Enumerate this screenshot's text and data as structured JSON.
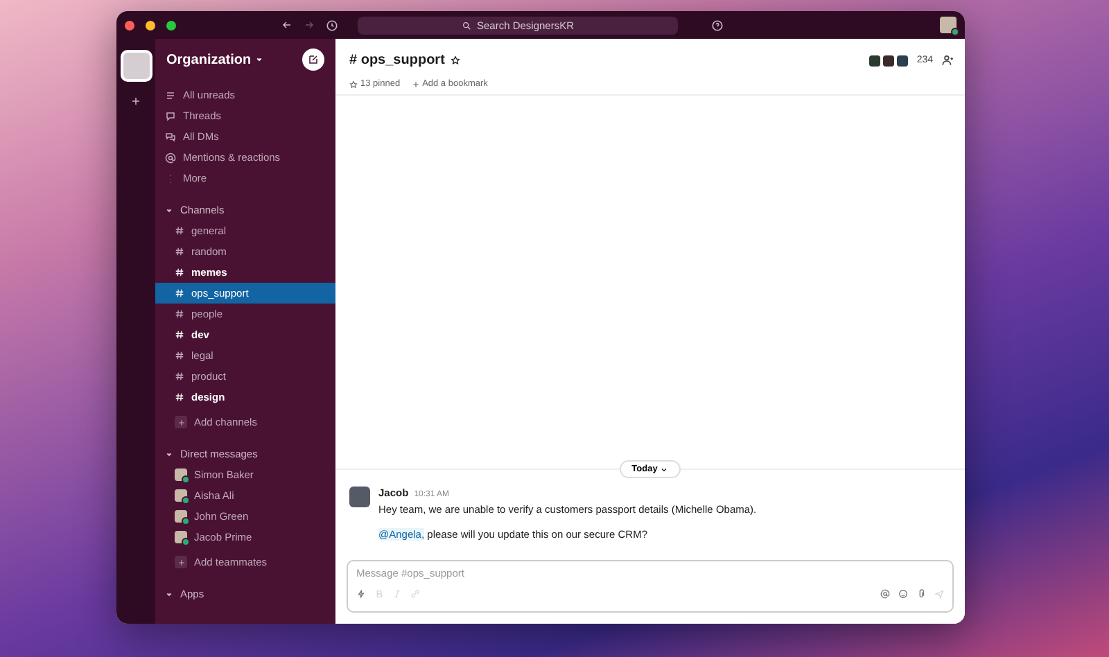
{
  "titlebar": {
    "search_placeholder": "Search DesignersKR"
  },
  "workspace": {
    "name": "Organization"
  },
  "sidebar": {
    "nav": [
      {
        "kind": "unreads",
        "label": "All unreads"
      },
      {
        "kind": "threads",
        "label": "Threads"
      },
      {
        "kind": "dms",
        "label": "All DMs"
      },
      {
        "kind": "mentions",
        "label": "Mentions & reactions"
      },
      {
        "kind": "more",
        "label": "More"
      }
    ],
    "channels_section": {
      "title": "Channels",
      "expanded": true,
      "items": [
        {
          "name": "general",
          "unread": false,
          "selected": false
        },
        {
          "name": "random",
          "unread": false,
          "selected": false
        },
        {
          "name": "memes",
          "unread": true,
          "selected": false
        },
        {
          "name": "ops_support",
          "unread": false,
          "selected": true
        },
        {
          "name": "people",
          "unread": false,
          "selected": false
        },
        {
          "name": "dev",
          "unread": true,
          "selected": false
        },
        {
          "name": "legal",
          "unread": false,
          "selected": false
        },
        {
          "name": "product",
          "unread": false,
          "selected": false
        },
        {
          "name": "design",
          "unread": true,
          "selected": false
        }
      ],
      "add_label": "Add channels"
    },
    "dm_section": {
      "title": "Direct messages",
      "expanded": true,
      "items": [
        {
          "name": "Simon Baker",
          "online": true
        },
        {
          "name": "Aisha Ali",
          "online": true
        },
        {
          "name": "John Green",
          "online": true
        },
        {
          "name": "Jacob Prime",
          "online": true
        }
      ],
      "add_label": "Add teammates"
    },
    "apps_section": {
      "title": "Apps",
      "expanded": true
    }
  },
  "channel": {
    "title": "# ops_support",
    "member_count": "234",
    "pinned": "13 pinned",
    "bookmark": "Add a bookmark"
  },
  "day_divider": "Today",
  "messages": [
    {
      "author": "Jacob",
      "time": "10:31 AM",
      "paragraphs": [
        {
          "text": "Hey team, we are unable to verify a customers passport details (Michelle Obama)."
        },
        {
          "mention": "@Angela,",
          "text": "please will you update this on our secure CRM?"
        }
      ]
    }
  ],
  "composer": {
    "placeholder": "Message #ops_support"
  }
}
